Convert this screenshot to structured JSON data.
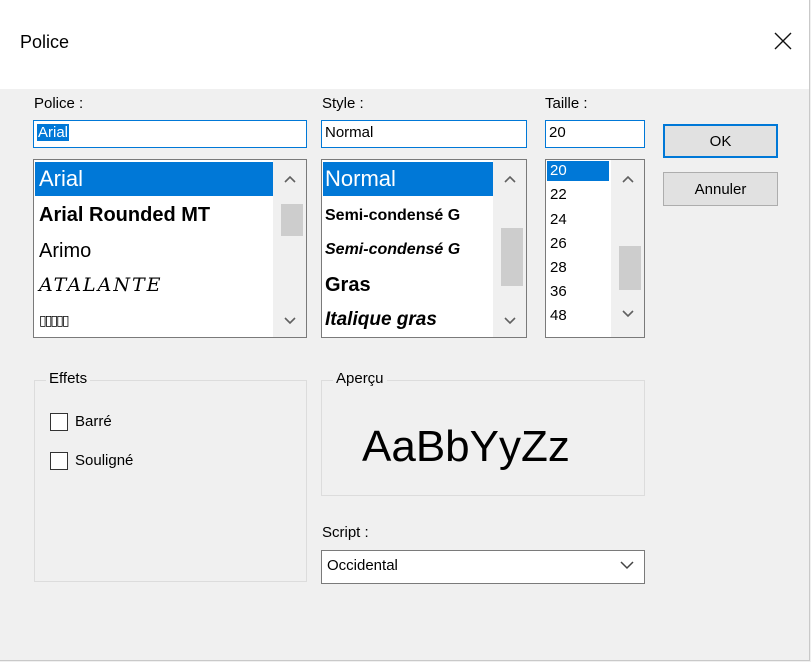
{
  "window": {
    "title": "Police"
  },
  "font": {
    "label": "Police :",
    "value": "Arial",
    "items": [
      {
        "label": "Arial",
        "selected": true
      },
      {
        "label": "Arial Rounded MT",
        "selected": false
      },
      {
        "label": "Arimo",
        "selected": false
      },
      {
        "label": "ATALANTE",
        "selected": false
      },
      {
        "label": "▯▯▯▯▯",
        "selected": false
      }
    ]
  },
  "style": {
    "label": "Style :",
    "value": "Normal",
    "items": [
      {
        "label": "Normal",
        "selected": true
      },
      {
        "label": "Semi-condensé G",
        "selected": false
      },
      {
        "label": "Semi-condensé G",
        "selected": false
      },
      {
        "label": "Gras",
        "selected": false
      },
      {
        "label": "Italique gras",
        "selected": false
      }
    ]
  },
  "size": {
    "label": "Taille :",
    "value": "20",
    "items": [
      {
        "label": "20",
        "selected": true
      },
      {
        "label": "22",
        "selected": false
      },
      {
        "label": "24",
        "selected": false
      },
      {
        "label": "26",
        "selected": false
      },
      {
        "label": "28",
        "selected": false
      },
      {
        "label": "36",
        "selected": false
      },
      {
        "label": "48",
        "selected": false
      }
    ]
  },
  "buttons": {
    "ok": "OK",
    "cancel": "Annuler"
  },
  "effects": {
    "title": "Effets",
    "strikeout": {
      "label": "Barré",
      "checked": false
    },
    "underline": {
      "label": "Souligné",
      "checked": false
    }
  },
  "preview": {
    "title": "Aperçu",
    "sample": "AaBbYyZz"
  },
  "script": {
    "label": "Script :",
    "value": "Occidental"
  },
  "colors": {
    "accent": "#0078d7",
    "background": "#f0f0f0"
  },
  "icons": {
    "close": "close-icon",
    "up": "chevron-up-icon",
    "down": "chevron-down-icon"
  }
}
